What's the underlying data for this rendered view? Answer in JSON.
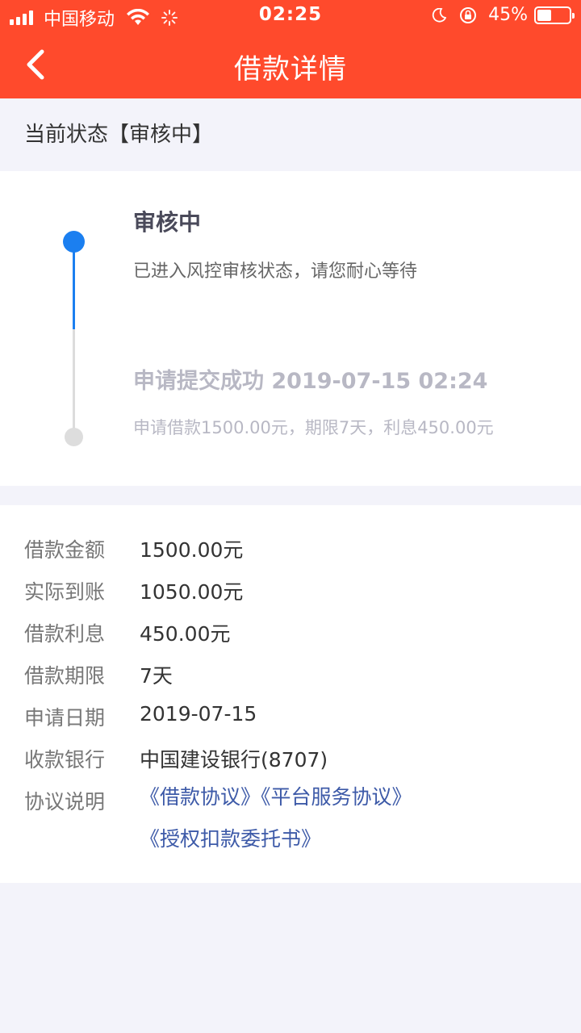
{
  "status_bar": {
    "carrier": "中国移动",
    "time": "02:25",
    "battery_percent": "45%",
    "battery_level": 0.45
  },
  "nav": {
    "title": "借款详情"
  },
  "current_status": {
    "text": "当前状态【审核中】"
  },
  "timeline": {
    "steps": [
      {
        "title": "审核中",
        "desc": "已进入风控审核状态，请您耐心等待",
        "active": true
      },
      {
        "title": "申请提交成功 2019-07-15 02:24",
        "desc": "申请借款1500.00元，期限7天，利息450.00元",
        "active": false
      }
    ]
  },
  "details": {
    "rows": [
      {
        "label": "借款金额",
        "value": "1500.00元"
      },
      {
        "label": "实际到账",
        "value": "1050.00元"
      },
      {
        "label": "借款利息",
        "value": "450.00元"
      },
      {
        "label": "借款期限",
        "value": "7天"
      },
      {
        "label": "申请日期",
        "value": "2019-07-15"
      },
      {
        "label": "收款银行",
        "value": "中国建设银行(8707)"
      }
    ],
    "agreement_label": "协议说明",
    "agreements": [
      "《借款协议》",
      "《平台服务协议》",
      "《授权扣款委托书》"
    ]
  },
  "colors": {
    "header": "#ff4a2c",
    "active": "#1b7ff0",
    "link": "#3d5aa8"
  }
}
